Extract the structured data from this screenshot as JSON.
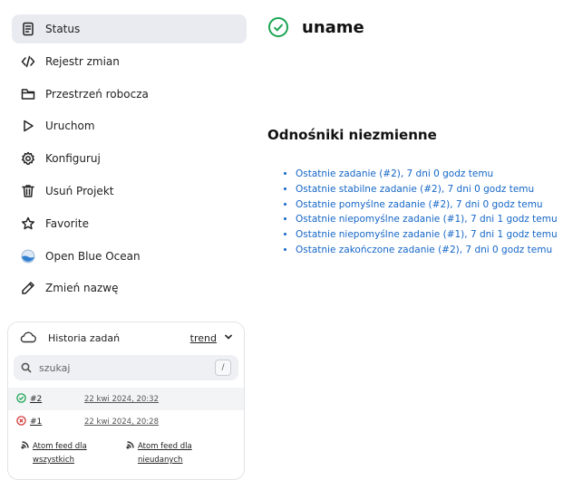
{
  "sidebar": {
    "items": [
      {
        "label": "Status",
        "icon": "document-icon"
      },
      {
        "label": "Rejestr zmian",
        "icon": "code-icon"
      },
      {
        "label": "Przestrzeń robocza",
        "icon": "folder-icon"
      },
      {
        "label": "Uruchom",
        "icon": "play-icon"
      },
      {
        "label": "Konfiguruj",
        "icon": "gear-icon"
      },
      {
        "label": "Usuń Projekt",
        "icon": "trash-icon"
      },
      {
        "label": "Favorite",
        "icon": "star-icon"
      },
      {
        "label": "Open Blue Ocean",
        "icon": "blue-ocean-icon"
      },
      {
        "label": "Zmień nazwę",
        "icon": "pencil-icon"
      }
    ]
  },
  "history": {
    "title": "Historia zadań",
    "trend": "trend",
    "search_placeholder": "szukaj",
    "shortcut_key": "/",
    "builds": [
      {
        "number": "#2",
        "date": "22 kwi 2024, 20:32",
        "status": "success"
      },
      {
        "number": "#1",
        "date": "22 kwi 2024, 20:28",
        "status": "failed"
      }
    ],
    "feeds": {
      "all": "Atom feed dla wszystkich",
      "failed": "Atom feed dla nieudanych"
    }
  },
  "main": {
    "job_name": "uname",
    "permalinks_title": "Odnośniki niezmienne",
    "permalinks": [
      "Ostatnie zadanie (#2), 7 dni 0 godz temu",
      "Ostatnie stabilne zadanie (#2), 7 dni 0 godz temu",
      "Ostatnie pomyślne zadanie (#2), 7 dni 0 godz temu",
      "Ostatnie niepomyślne zadanie (#1), 7 dni 1 godz temu",
      "Ostatnie niepomyślne zadanie (#1), 7 dni 1 godz temu",
      "Ostatnie zakończone zadanie (#2), 7 dni 0 godz temu"
    ]
  },
  "colors": {
    "success": "#1aa452",
    "failure": "#d33a3a",
    "link": "#1466c7",
    "active_bg": "#e9ebf0"
  }
}
